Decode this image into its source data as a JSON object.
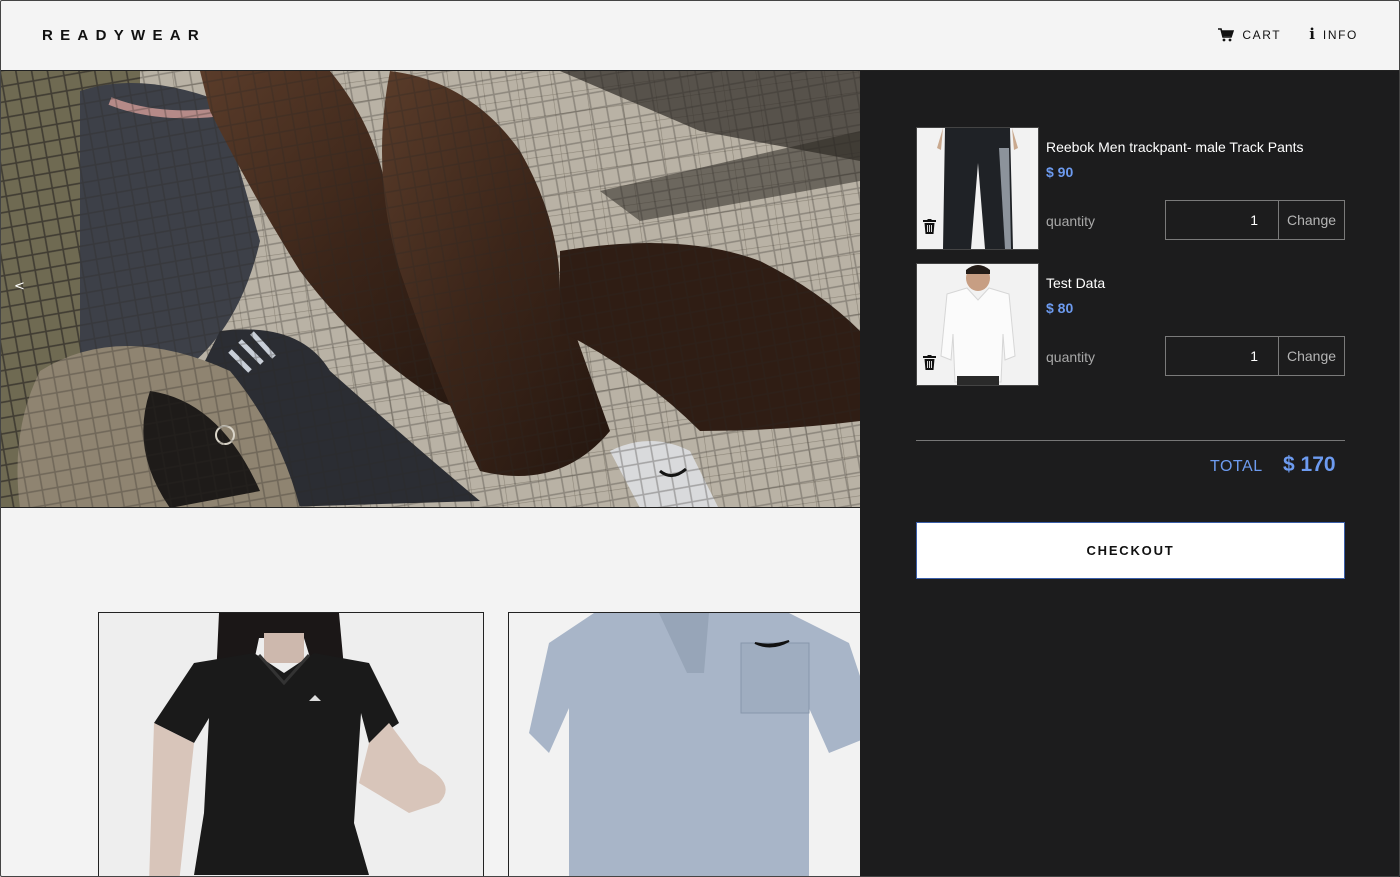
{
  "header": {
    "brand": "READYWEAR",
    "nav": [
      {
        "label": "CART",
        "icon": "cart-icon"
      },
      {
        "label": "INFO",
        "icon": "info-icon"
      }
    ]
  },
  "hero": {
    "prev_arrow": "<"
  },
  "cart": {
    "items": [
      {
        "name": "Reebok Men trackpant- male Track Pants",
        "price": "$ 90",
        "quantity_label": "quantity",
        "quantity": "1",
        "change_label": "Change"
      },
      {
        "name": "Test Data",
        "price": "$ 80",
        "quantity_label": "quantity",
        "quantity": "1",
        "change_label": "Change"
      }
    ],
    "total_label": "TOTAL",
    "total_value": "$ 170",
    "checkout_label": "CHECKOUT"
  },
  "colors": {
    "accent": "#6d9bf0",
    "panel": "#1c1c1d",
    "background": "#f3f3f3"
  }
}
